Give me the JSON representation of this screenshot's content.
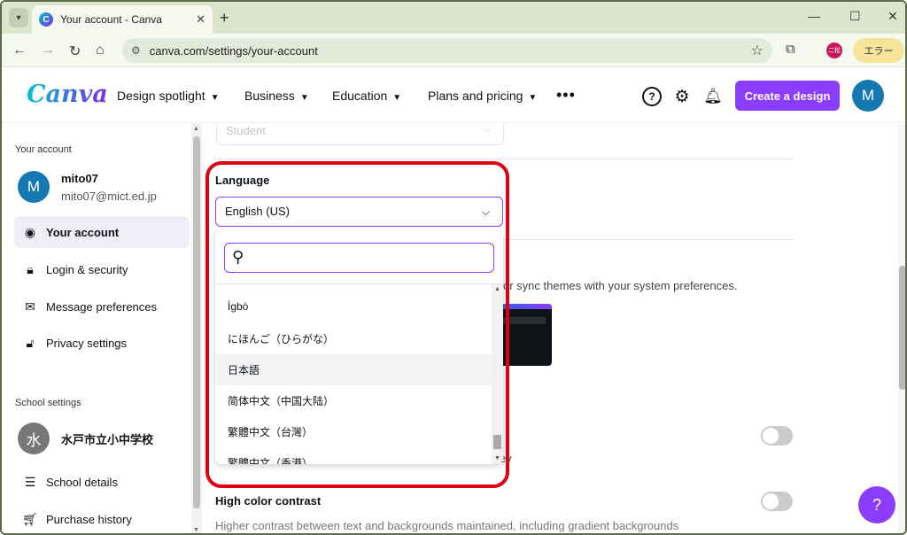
{
  "browser": {
    "tab_title": "Your account - Canva",
    "url": "canva.com/settings/your-account",
    "profile_label": "二松",
    "error_button": "エラー"
  },
  "header": {
    "logo": "Canva",
    "nav": [
      {
        "label": "Design spotlight"
      },
      {
        "label": "Business"
      },
      {
        "label": "Education"
      },
      {
        "label": "Plans and pricing"
      }
    ],
    "create_button": "Create a design",
    "avatar_initial": "M"
  },
  "sidebar": {
    "account_heading": "Your account",
    "user_name": "mito07",
    "user_email": "mito07@mict.ed.jp",
    "user_initial": "M",
    "items": [
      {
        "label": "Your account",
        "icon": "person-icon",
        "active": true
      },
      {
        "label": "Login & security",
        "icon": "lock-icon"
      },
      {
        "label": "Message preferences",
        "icon": "envelope-icon"
      },
      {
        "label": "Privacy settings",
        "icon": "padlock-icon"
      }
    ],
    "school_heading": "School settings",
    "school_name": "水戸市立小中学校",
    "school_initial": "水",
    "school_items": [
      {
        "label": "School details",
        "icon": "list-icon"
      },
      {
        "label": "Purchase history",
        "icon": "cart-icon"
      }
    ]
  },
  "main": {
    "role_value": "Student",
    "language_label": "Language",
    "language_value": "English (US)",
    "theme_description": "or sync themes with your system preferences.",
    "key_text": "ey",
    "high_contrast_title": "High color contrast",
    "high_contrast_desc": "Higher contrast between text and backgrounds maintained, including gradient backgrounds"
  },
  "dropdown": {
    "search_placeholder": "",
    "options": [
      "Ìgbò",
      "にほんご（ひらがな）",
      "日本語",
      "简体中文（中国大陆）",
      "繁體中文（台灣）",
      "繁體中文（香港）"
    ],
    "hovered_index": 2
  },
  "colors": {
    "brand_purple": "#8b3dff",
    "annotation_red": "#e00012"
  }
}
